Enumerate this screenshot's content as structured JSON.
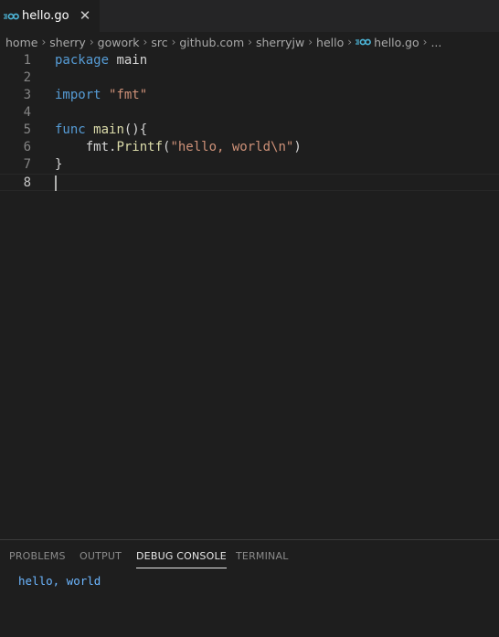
{
  "tabs": [
    {
      "label": "hello.go",
      "icon": "go-file-icon",
      "close_symbol": "✕"
    }
  ],
  "breadcrumbs": {
    "items": [
      "home",
      "sherry",
      "gowork",
      "src",
      "github.com",
      "sherryjw",
      "hello",
      "hello.go",
      "..."
    ]
  },
  "editor": {
    "line_numbers": [
      "1",
      "2",
      "3",
      "4",
      "5",
      "6",
      "7",
      "8"
    ],
    "current_line": 8,
    "tokens": {
      "l1_kw": "package",
      "l1_rest": " main",
      "l3_kw": "import",
      "l3_sp": " ",
      "l3_str": "\"fmt\"",
      "l5_kw": "func",
      "l5_sp": " ",
      "l5_fn": "main",
      "l5_rest": "(){",
      "l6_indent": "    ",
      "l6_pkg": "fmt.",
      "l6_fn": "Printf",
      "l6_open": "(",
      "l6_str": "\"hello, world\\n\"",
      "l6_close": ")",
      "l7_brace": "}"
    }
  },
  "panel": {
    "tabs": [
      "PROBLEMS",
      "OUTPUT",
      "DEBUG CONSOLE",
      "TERMINAL"
    ],
    "active_tab": "DEBUG CONSOLE",
    "output": "hello, world"
  },
  "colors": {
    "background": "#1e1e1e",
    "keyword": "#569cd6",
    "string": "#ce9178",
    "function": "#dcdcaa",
    "console_text": "#6cb6ff"
  }
}
